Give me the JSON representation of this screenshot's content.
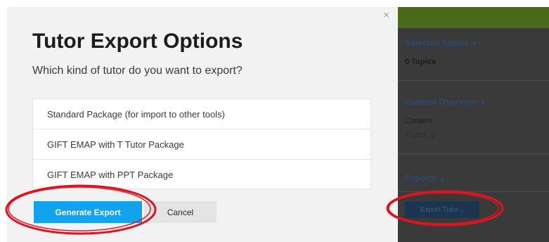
{
  "modal": {
    "close_glyph": "×",
    "title": "Tutor Export Options",
    "subtitle": "Which kind of tutor do you want to export?",
    "options": [
      {
        "label": "Standard Package (for import to other tools)"
      },
      {
        "label": "GIFT EMAP with T Tutor Package"
      },
      {
        "label": "GIFT EMAP with PPT Package"
      }
    ],
    "generate_label": "Generate Export",
    "cancel_label": "Cancel"
  },
  "background_panel": {
    "selected_topics_heading": "Selected Topics",
    "selected_topics_count": "0 Topics",
    "content_overview_heading": "Content Overview",
    "content_label": "Content",
    "topics_count": "Topics: 0",
    "exports_heading": "Exports",
    "export_tutor_label": "Export Tutor..."
  },
  "colors": {
    "primary_button": "#11a3ee",
    "annotation": "#e0141e",
    "overlay": "#3a3a3a"
  },
  "icons": {
    "close": "close-icon",
    "collapse_down": "caret-down-icon",
    "collapse_up": "caret-up-icon"
  }
}
